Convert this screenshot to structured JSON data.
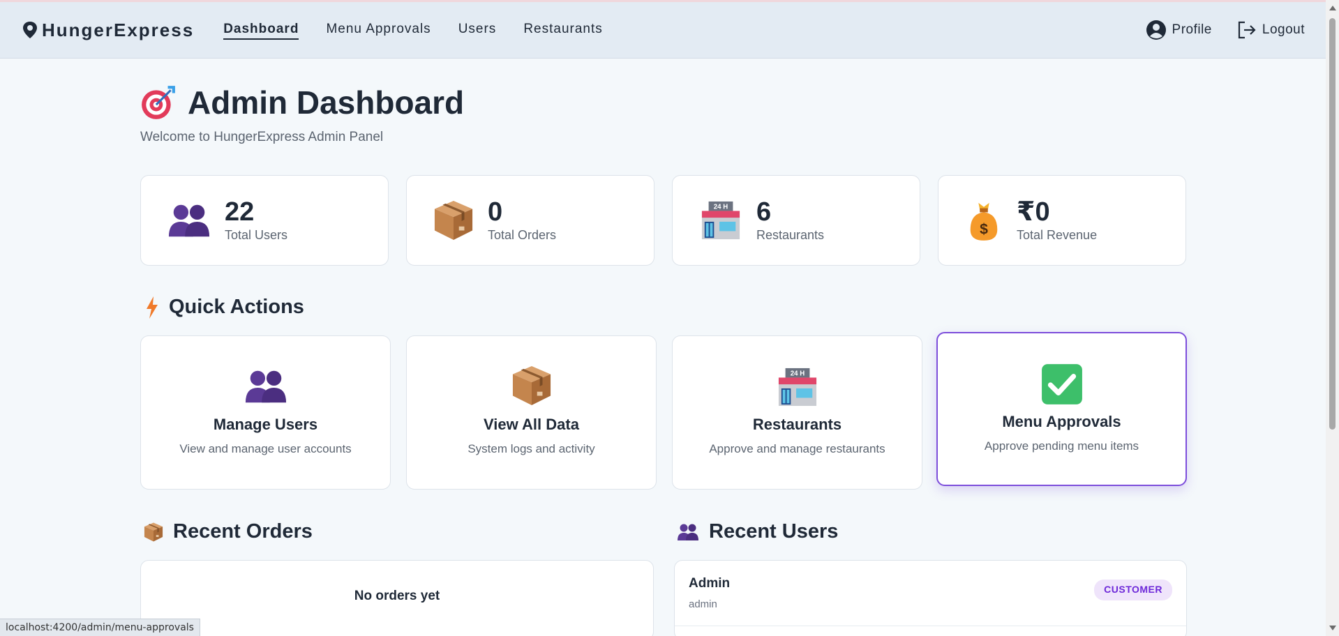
{
  "brand": {
    "name": "HungerExpress"
  },
  "nav": {
    "links": [
      {
        "label": "Dashboard",
        "active": true
      },
      {
        "label": "Menu Approvals"
      },
      {
        "label": "Users"
      },
      {
        "label": "Restaurants"
      }
    ],
    "profile_label": "Profile",
    "logout_label": "Logout"
  },
  "header": {
    "title": "Admin Dashboard",
    "subtitle": "Welcome to HungerExpress Admin Panel"
  },
  "stats": [
    {
      "value": "22",
      "label": "Total Users",
      "icon": "users-icon"
    },
    {
      "value": "0",
      "label": "Total Orders",
      "icon": "package-icon"
    },
    {
      "value": "6",
      "label": "Restaurants",
      "icon": "store-icon"
    },
    {
      "value": "₹0",
      "label": "Total Revenue",
      "icon": "money-bag-icon"
    }
  ],
  "quick_actions": {
    "title": "Quick Actions",
    "items": [
      {
        "title": "Manage Users",
        "desc": "View and manage user accounts",
        "icon": "users-icon"
      },
      {
        "title": "View All Data",
        "desc": "System logs and activity",
        "icon": "package-icon"
      },
      {
        "title": "Restaurants",
        "desc": "Approve and manage restaurants",
        "icon": "store-icon"
      },
      {
        "title": "Menu Approvals",
        "desc": "Approve pending menu items",
        "icon": "check-icon"
      }
    ]
  },
  "recent_orders": {
    "title": "Recent Orders",
    "empty_text": "No orders yet"
  },
  "recent_users": {
    "title": "Recent Users",
    "users": [
      {
        "name": "Admin",
        "username": "admin",
        "role": "CUSTOMER"
      }
    ]
  },
  "status_bar": {
    "url": "localhost:4200/admin/menu-approvals"
  },
  "colors": {
    "accent": "#7c4ddb",
    "badge_bg": "#efe4fb",
    "badge_text": "#6d28d9",
    "navbar_bg": "#e3ebf3"
  }
}
